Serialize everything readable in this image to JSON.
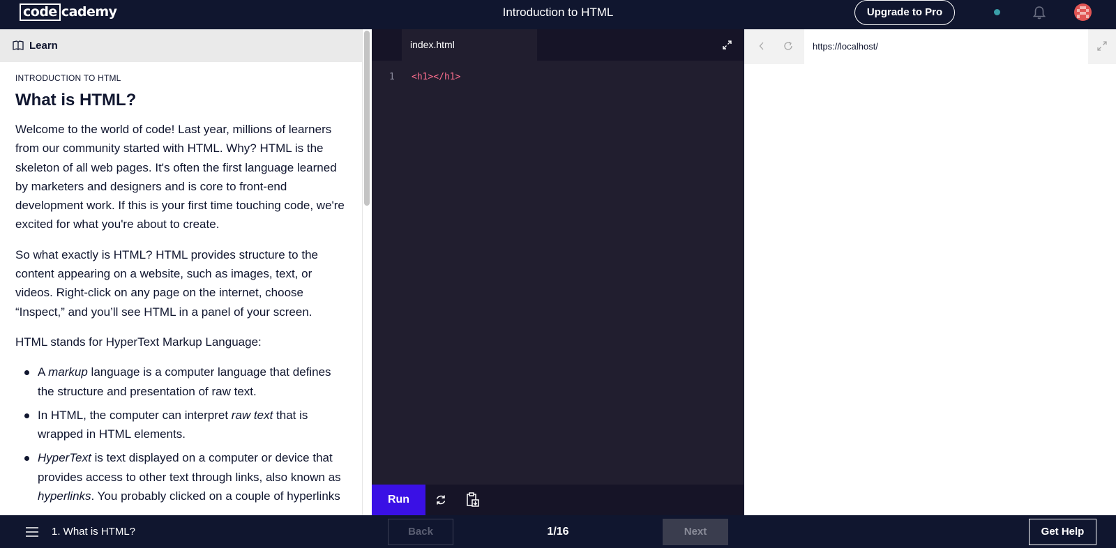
{
  "brand": {
    "logo_left": "code",
    "logo_right": "cademy"
  },
  "header": {
    "title": "Introduction to HTML",
    "upgrade_label": "Upgrade to Pro"
  },
  "learn_panel": {
    "tab_label": "Learn",
    "eyebrow": "INTRODUCTION TO HTML",
    "heading": "What is HTML?",
    "paragraphs": [
      "Welcome to the world of code! Last year, millions of learners from our community started with HTML. Why? HTML is the skeleton of all web pages. It's often the first language learned by marketers and designers and is core to front-end development work. If this is your first time touching code, we're excited for what you're about to create.",
      "So what exactly is HTML? HTML provides structure to the content appearing on a website, such as images, text, or videos. Right-click on any page on the internet, choose “Inspect,” and you’ll see HTML in a panel of your screen.",
      "HTML stands for HyperText Markup Language:"
    ],
    "bullets": [
      {
        "pre": "A ",
        "em": "markup",
        "post": " language is a computer language that defines the structure and presentation of raw text."
      },
      {
        "pre": "In HTML, the computer can interpret ",
        "em": "raw text",
        "post": " that is wrapped in HTML elements."
      },
      {
        "pre": "",
        "em": "HyperText",
        "post": " is text displayed on a computer or device that provides access to other text through links, also known as ",
        "em2": "hyperlinks",
        "post2": ". You probably clicked on a couple of hyperlinks"
      }
    ]
  },
  "editor": {
    "file_tab": "index.html",
    "lines": [
      {
        "number": "1",
        "code": "<h1></h1>"
      }
    ],
    "run_label": "Run"
  },
  "preview": {
    "url": "https://localhost/"
  },
  "footer": {
    "lesson_label": "1. What is HTML?",
    "back_label": "Back",
    "progress": "1/16",
    "next_label": "Next",
    "help_label": "Get Help"
  }
}
